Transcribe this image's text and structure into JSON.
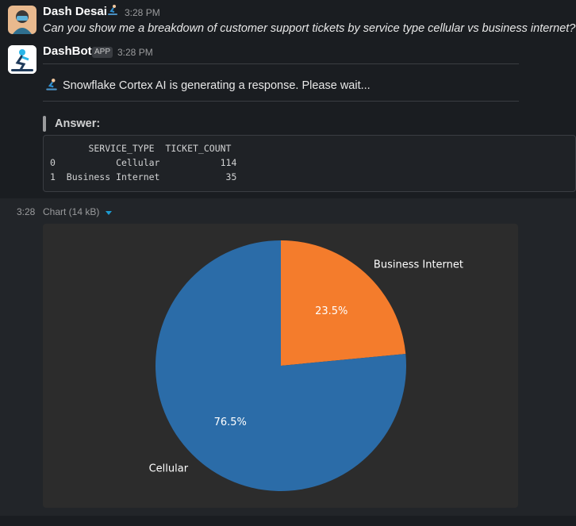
{
  "message1": {
    "author": "Dash Desai",
    "status_emoji": "snowboarder-emoji",
    "time": "3:28 PM",
    "text": "Can you show me a breakdown of customer support tickets by service type cellular vs business internet?"
  },
  "message2": {
    "author": "DashBot",
    "badge": "APP",
    "time": "3:28 PM",
    "status_text": "Snowflake Cortex AI is generating a response. Please wait...",
    "answer_label": "Answer:",
    "table": {
      "header": "       SERVICE_TYPE  TICKET_COUNT",
      "rows": [
        "0           Cellular           114",
        "1  Business Internet            35"
      ]
    }
  },
  "attachment": {
    "time": "3:28",
    "label": "Chart (14 kB)"
  },
  "chart_data": {
    "type": "pie",
    "categories": [
      "Business Internet",
      "Cellular"
    ],
    "values": [
      35,
      114
    ],
    "percent_labels": [
      "23.5%",
      "76.5%"
    ],
    "colors": [
      "#f47c2c",
      "#2b6ca8"
    ],
    "start_angle_deg": 90,
    "direction": "clockwise"
  }
}
